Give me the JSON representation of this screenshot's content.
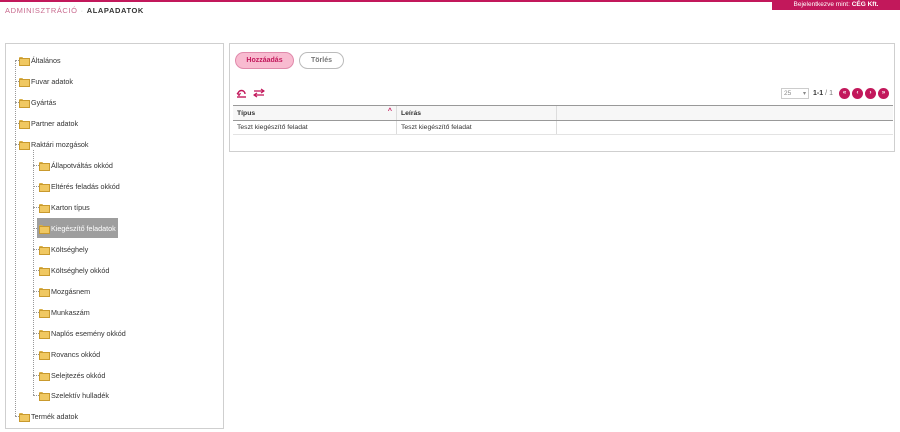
{
  "header": {
    "breadcrumb_root": "ADMINISZTRÁCIÓ",
    "breadcrumb_sep": "·",
    "breadcrumb_current": "ALAPADATOK",
    "login_prefix": "Bejelentkezve mint:",
    "login_company": "CÉG Kft."
  },
  "tree": {
    "items": [
      {
        "label": "Általános"
      },
      {
        "label": "Fuvar adatok"
      },
      {
        "label": "Gyártás"
      },
      {
        "label": "Partner adatok"
      },
      {
        "label": "Raktári mozgások"
      },
      {
        "label": "Termék adatok"
      }
    ],
    "children": [
      {
        "label": "Állapotváltás okkód"
      },
      {
        "label": "Eltérés feladás okkód"
      },
      {
        "label": "Karton típus"
      },
      {
        "label": "Kiegészítő feladatok"
      },
      {
        "label": "Költséghely"
      },
      {
        "label": "Költséghely okkód"
      },
      {
        "label": "Mozgásnem"
      },
      {
        "label": "Munkaszám"
      },
      {
        "label": "Naplós esemény okkód"
      },
      {
        "label": "Rovancs okkód"
      },
      {
        "label": "Selejtezés okkód"
      },
      {
        "label": "Szelektív hulladék"
      }
    ],
    "selected": "Kiegészítő feladatok"
  },
  "toolbar": {
    "add_label": "Hozzáadás",
    "delete_label": "Törlés"
  },
  "icons": {
    "refresh": "refresh-icon",
    "swap": "swap-icon",
    "first": "first-page-icon",
    "prev": "prev-page-icon",
    "next": "next-page-icon",
    "last": "last-page-icon"
  },
  "pager": {
    "page_size": "25",
    "range": "1-1",
    "slash": "/",
    "total": "1"
  },
  "grid": {
    "columns": [
      "Típus",
      "Leírás",
      ""
    ],
    "rows": [
      [
        "Teszt kiegészítő feladat",
        "Teszt kiegészítő feladat",
        ""
      ]
    ]
  },
  "colors": {
    "accent": "#c2185b",
    "accent_light": "#f8bbd0",
    "selected_bg": "#9e9e9e"
  }
}
